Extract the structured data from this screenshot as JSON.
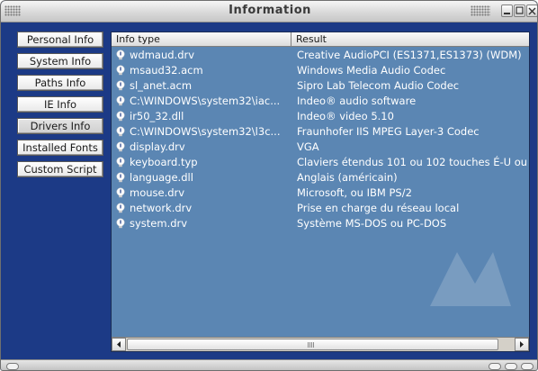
{
  "window": {
    "title": "Information"
  },
  "nav": {
    "items": [
      {
        "label": "Personal Info"
      },
      {
        "label": "System Info"
      },
      {
        "label": "Paths Info"
      },
      {
        "label": "IE Info"
      },
      {
        "label": "Drivers Info"
      },
      {
        "label": "Installed Fonts"
      },
      {
        "label": "Custom Script"
      }
    ],
    "active": "Drivers Info"
  },
  "list": {
    "columns": {
      "type": "Info type",
      "result": "Result"
    },
    "rows": [
      {
        "type": "wdmaud.drv",
        "result": "Creative AudioPCI (ES1371,ES1373) (WDM)"
      },
      {
        "type": "msaud32.acm",
        "result": "Windows Media Audio Codec"
      },
      {
        "type": "sl_anet.acm",
        "result": "Sipro Lab Telecom Audio Codec"
      },
      {
        "type": "C:\\WINDOWS\\system32\\iac...",
        "result": "Indeo® audio software"
      },
      {
        "type": "ir50_32.dll",
        "result": "Indeo® video 5.10"
      },
      {
        "type": "C:\\WINDOWS\\system32\\l3c...",
        "result": "Fraunhofer IIS MPEG Layer-3 Codec"
      },
      {
        "type": "display.drv",
        "result": "VGA"
      },
      {
        "type": "keyboard.typ",
        "result": "Claviers étendus 101 ou 102 touches É-U ou"
      },
      {
        "type": "language.dll",
        "result": "Anglais (américain)"
      },
      {
        "type": "mouse.drv",
        "result": "Microsoft, ou IBM PS/2"
      },
      {
        "type": "network.drv",
        "result": "Prise en charge du réseau local"
      },
      {
        "type": "system.drv",
        "result": "Système MS-DOS ou PC-DOS"
      }
    ],
    "row_icon": "info-bulb-icon"
  },
  "colors": {
    "frame_blue": "#1c3a86",
    "list_bg": "#5b86b3",
    "row_text": "#ffffff"
  }
}
